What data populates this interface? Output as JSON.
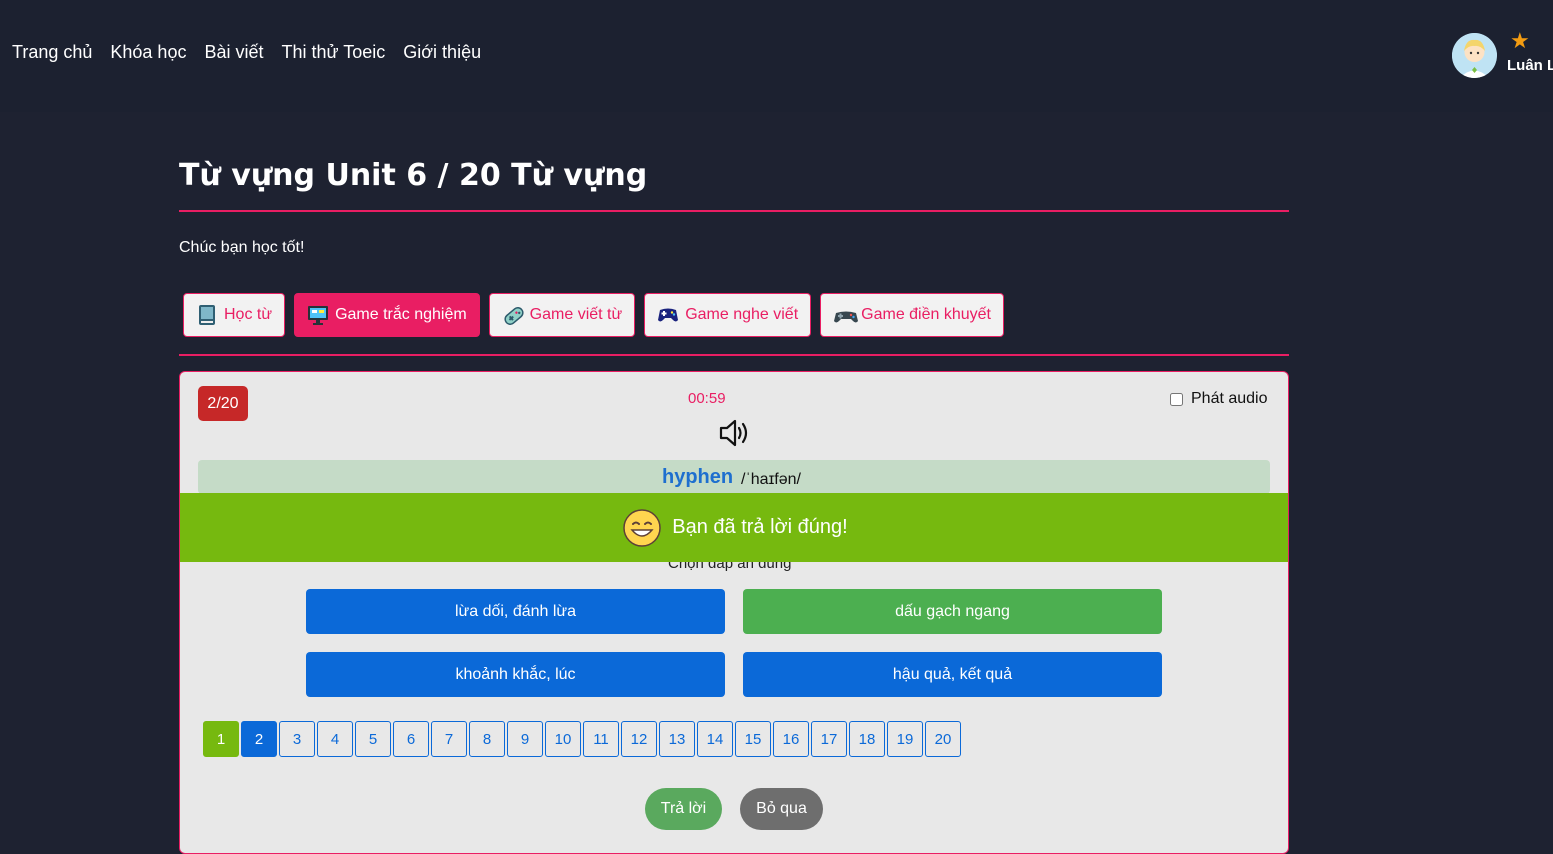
{
  "nav": {
    "items": [
      "Trang chủ",
      "Khóa học",
      "Bài viết",
      "Thi thử Toeic",
      "Giới thiệu"
    ]
  },
  "user": {
    "name": "Luân L"
  },
  "header": {
    "title": "Từ vựng Unit 6 / 20 Từ vựng",
    "subtitle": "Chúc bạn học tốt!"
  },
  "tabs": [
    {
      "label": "Học từ",
      "icon": "book-icon",
      "active": false
    },
    {
      "label": "Game trắc nghiệm",
      "icon": "monitor-icon",
      "active": true
    },
    {
      "label": "Game viết từ",
      "icon": "gamepad-icon",
      "active": false
    },
    {
      "label": "Game nghe viết",
      "icon": "controller-icon",
      "active": false
    },
    {
      "label": "Game điền khuyết",
      "icon": "joystick-icon",
      "active": false
    }
  ],
  "game": {
    "counter": "2/20",
    "timer": "00:59",
    "audio_label": "Phát audio",
    "word": "hyphen",
    "phonetic": "/ˈhaɪfən/",
    "feedback": "Bạn đã trả lời đúng!",
    "prompt": "Chọn đáp án đúng",
    "answers": [
      "lừa dối, đánh lừa",
      "dấu gạch ngang",
      "khoảnh khắc, lúc",
      "hậu quả, kết quả"
    ],
    "correct_index": 1,
    "pages": [
      "1",
      "2",
      "3",
      "4",
      "5",
      "6",
      "7",
      "8",
      "9",
      "10",
      "11",
      "12",
      "13",
      "14",
      "15",
      "16",
      "17",
      "18",
      "19",
      "20"
    ],
    "answer_button": "Trả lời",
    "skip_button": "Bỏ qua"
  },
  "colors": {
    "accent": "#e91e63",
    "primary": "#0b69d8",
    "success": "#76b90f",
    "correct_answer": "#4caf50",
    "counter": "#c62828"
  }
}
